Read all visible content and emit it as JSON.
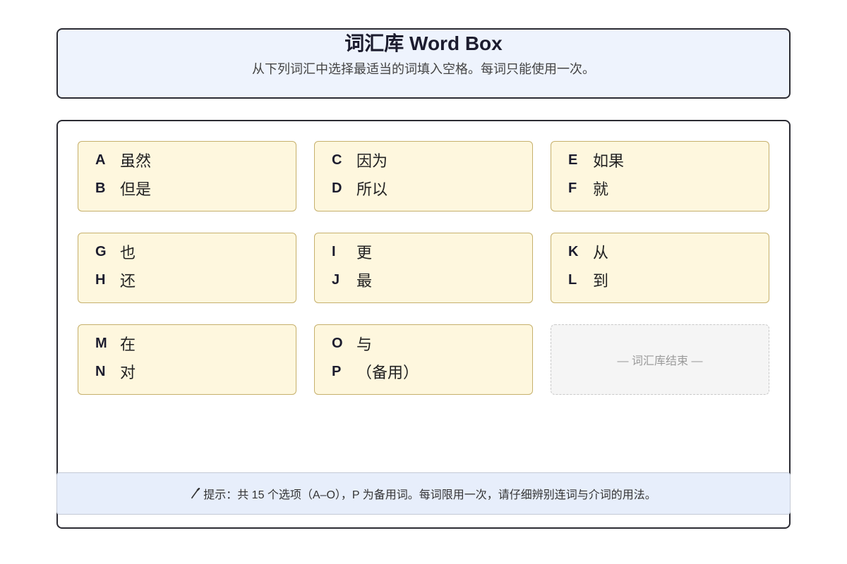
{
  "header": {
    "title": "词汇库 Word Box",
    "subtitle": "从下列词汇中选择最适当的词填入空格。每词只能使用一次。"
  },
  "word_box": {
    "groups": [
      {
        "items": [
          {
            "letter": "A",
            "word": "虽然"
          },
          {
            "letter": "B",
            "word": "但是"
          }
        ]
      },
      {
        "items": [
          {
            "letter": "C",
            "word": "因为"
          },
          {
            "letter": "D",
            "word": "所以"
          }
        ]
      },
      {
        "items": [
          {
            "letter": "E",
            "word": "如果"
          },
          {
            "letter": "F",
            "word": "就"
          }
        ]
      },
      {
        "items": [
          {
            "letter": "G",
            "word": "也"
          },
          {
            "letter": "H",
            "word": "还"
          }
        ]
      },
      {
        "items": [
          {
            "letter": "I",
            "word": "更"
          },
          {
            "letter": "J",
            "word": "最"
          }
        ]
      },
      {
        "items": [
          {
            "letter": "K",
            "word": "从"
          },
          {
            "letter": "L",
            "word": "到"
          }
        ]
      },
      {
        "items": [
          {
            "letter": "M",
            "word": "在"
          },
          {
            "letter": "N",
            "word": "对"
          }
        ]
      },
      {
        "items": [
          {
            "letter": "O",
            "word": "与"
          },
          {
            "letter": "P",
            "word": "（备用）"
          }
        ]
      }
    ],
    "end_marker": "— 词汇库结束 —"
  },
  "footer": {
    "icon": "pencil-icon",
    "hint": "提示：共 15 个选项（A–O），P 为备用词。每词限用一次，请仔细辨别连词与介词的用法。"
  },
  "colors": {
    "header_bg": "#eef3fd",
    "card_bg": "#fef7de",
    "card_border": "#c6b06c",
    "footer_bg": "#e7eefb"
  }
}
